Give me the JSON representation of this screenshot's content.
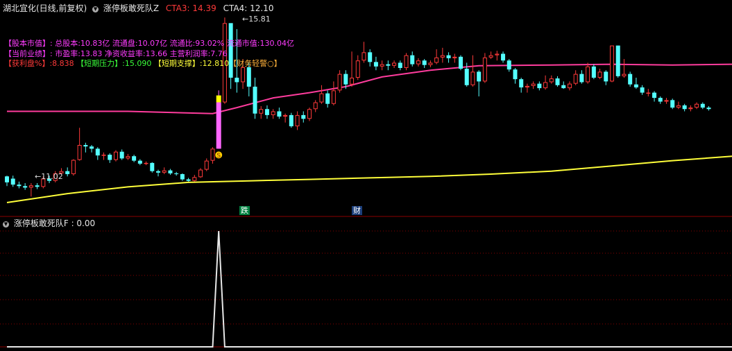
{
  "header": {
    "title": "湖北宜化(日线,前复权)",
    "indicator": "涨停板敢死队Z",
    "cta3_label": "CTA3:",
    "cta3_value": "14.39",
    "cta4_label": "CTA4:",
    "cta4_value": "12.10"
  },
  "info": {
    "row1": {
      "tag": "【股本市值】:",
      "text": "总股本:10.83亿 流通盘:10.07亿 流通比:93.02% 流通市值:130.04亿"
    },
    "row2": {
      "tag": "【当前业绩】:",
      "text": "市盈率:13.83 净资收益率:13.66 主营利润率:7.76"
    },
    "row3": {
      "profit_label": "【获利盘%】:",
      "profit_value": "8.838",
      "pressure_label": "【短期压力】:",
      "pressure_value": "15.090",
      "support_label": "【短期支撑】:",
      "support_value": "12.810",
      "warn": "【财务轻警○】"
    }
  },
  "markers": {
    "high_label": "15.81",
    "low_label": "11.02",
    "signal_icon": "S",
    "tag_die": "跌",
    "tag_cai": "财"
  },
  "sub_panel": {
    "title": "涨停板敢死队F",
    "value_label": ": 0.00"
  },
  "colors": {
    "up": "#ff3a3a",
    "down": "#54ffff",
    "ma1": "#ff3c9d",
    "ma2": "#ffff3a",
    "signal": "#ff66ff",
    "signal_top": "#ffff00",
    "grid": "#8b0000",
    "white": "#e8e8e8",
    "tag_die_bg": "#008040",
    "tag_cai_bg": "#1c3e7a"
  },
  "chart_data": [
    {
      "type": "candlestick",
      "series": [
        {
          "name": "candles",
          "values": [
            [
              11.56,
              11.4,
              11.58,
              11.3
            ],
            [
              11.5,
              11.34,
              11.58,
              11.28
            ],
            [
              11.34,
              11.3,
              11.42,
              11.24
            ],
            [
              11.3,
              11.26,
              11.38,
              11.2
            ],
            [
              11.26,
              11.32,
              11.38,
              11.02
            ],
            [
              11.32,
              11.28,
              11.38,
              11.22
            ],
            [
              11.28,
              11.5,
              11.56,
              11.24
            ],
            [
              11.5,
              11.44,
              11.58,
              11.38
            ],
            [
              11.44,
              11.64,
              11.7,
              11.4
            ],
            [
              11.64,
              11.7,
              11.78,
              11.6
            ],
            [
              11.7,
              11.62,
              11.8,
              11.56
            ],
            [
              11.62,
              12.0,
              12.02,
              11.58
            ],
            [
              12.0,
              12.4,
              12.86,
              11.98
            ],
            [
              12.4,
              12.36,
              12.46,
              12.2
            ],
            [
              12.36,
              12.3,
              12.4,
              12.2
            ],
            [
              12.3,
              12.12,
              12.34,
              12.0
            ],
            [
              12.12,
              12.14,
              12.2,
              12.0
            ],
            [
              12.14,
              12.0,
              12.18,
              11.92
            ],
            [
              12.0,
              12.22,
              12.26,
              11.96
            ],
            [
              12.22,
              12.04,
              12.28,
              12.0
            ],
            [
              12.04,
              12.1,
              12.16,
              12.0
            ],
            [
              12.1,
              11.98,
              12.14,
              11.94
            ],
            [
              11.98,
              11.9,
              12.02,
              11.86
            ],
            [
              11.9,
              11.92,
              11.96,
              11.86
            ],
            [
              11.92,
              11.7,
              11.94,
              11.66
            ],
            [
              11.7,
              11.66,
              11.74,
              11.56
            ],
            [
              11.66,
              11.72,
              11.8,
              11.62
            ],
            [
              11.72,
              11.64,
              11.76,
              11.6
            ],
            [
              11.64,
              11.62,
              11.68,
              11.58
            ],
            [
              11.62,
              11.48,
              11.64,
              11.44
            ],
            [
              11.48,
              11.44,
              11.52,
              11.42
            ],
            [
              11.44,
              11.54,
              11.6,
              11.42
            ],
            [
              11.54,
              11.74,
              11.78,
              11.52
            ],
            [
              11.74,
              11.98,
              12.04,
              11.7
            ],
            [
              11.98,
              12.3,
              12.34,
              11.9
            ],
            [
              12.3,
              13.54,
              13.86,
              12.3
            ],
            [
              13.54,
              15.66,
              15.81,
              13.5
            ],
            [
              15.66,
              14.2,
              14.6,
              13.9
            ],
            [
              14.2,
              14.08,
              15.5,
              13.8
            ],
            [
              14.08,
              14.48,
              14.7,
              13.9
            ],
            [
              14.48,
              13.96,
              14.6,
              13.7
            ],
            [
              13.96,
              13.24,
              14.2,
              13.1
            ],
            [
              13.24,
              13.36,
              13.44,
              13.1
            ],
            [
              13.36,
              13.2,
              13.46,
              13.1
            ],
            [
              13.2,
              13.3,
              13.36,
              13.1
            ],
            [
              13.3,
              13.16,
              13.4,
              13.1
            ],
            [
              13.16,
              13.2,
              13.24,
              13.0
            ],
            [
              13.2,
              12.9,
              13.26,
              12.86
            ],
            [
              12.9,
              13.2,
              13.3,
              12.8
            ],
            [
              13.2,
              13.1,
              13.3,
              13.0
            ],
            [
              13.1,
              13.36,
              13.4,
              13.04
            ],
            [
              13.36,
              13.54,
              13.6,
              13.28
            ],
            [
              13.54,
              13.78,
              14.0,
              13.5
            ],
            [
              13.78,
              13.5,
              13.86,
              13.4
            ],
            [
              13.5,
              13.86,
              14.1,
              13.46
            ],
            [
              13.86,
              14.3,
              14.4,
              13.8
            ],
            [
              14.3,
              14.02,
              14.4,
              13.9
            ],
            [
              14.02,
              14.2,
              14.9,
              13.96
            ],
            [
              14.2,
              14.66,
              14.8,
              14.14
            ],
            [
              14.66,
              14.88,
              15.16,
              14.6
            ],
            [
              14.88,
              14.62,
              14.96,
              14.5
            ],
            [
              14.62,
              14.5,
              14.76,
              14.4
            ],
            [
              14.5,
              14.56,
              14.66,
              14.4
            ],
            [
              14.56,
              14.52,
              14.66,
              14.4
            ],
            [
              14.52,
              14.6,
              14.66,
              14.46
            ],
            [
              14.6,
              14.46,
              14.66,
              14.4
            ],
            [
              14.46,
              14.8,
              14.86,
              14.4
            ],
            [
              14.8,
              14.56,
              14.9,
              14.5
            ],
            [
              14.56,
              14.66,
              14.72,
              14.5
            ],
            [
              14.66,
              14.54,
              14.7,
              14.46
            ],
            [
              14.54,
              14.6,
              14.66,
              14.48
            ],
            [
              14.6,
              14.74,
              14.96,
              14.56
            ],
            [
              14.74,
              14.8,
              15.0,
              14.6
            ],
            [
              14.8,
              14.72,
              14.88,
              14.6
            ],
            [
              14.72,
              14.76,
              14.84,
              14.6
            ],
            [
              14.76,
              14.44,
              14.8,
              14.4
            ],
            [
              14.44,
              14.0,
              14.6,
              13.96
            ],
            [
              14.0,
              14.36,
              14.8,
              13.96
            ],
            [
              14.36,
              14.1,
              14.4,
              13.7
            ],
            [
              14.1,
              14.74,
              14.86,
              14.06
            ],
            [
              14.74,
              14.8,
              14.9,
              14.7
            ],
            [
              14.8,
              14.84,
              14.92,
              14.66
            ],
            [
              14.84,
              14.66,
              14.9,
              14.6
            ],
            [
              14.66,
              14.42,
              14.7,
              14.36
            ],
            [
              14.42,
              14.16,
              14.46,
              14.04
            ],
            [
              14.16,
              13.94,
              14.2,
              13.8
            ],
            [
              13.94,
              13.98,
              14.04,
              13.8
            ],
            [
              13.98,
              14.04,
              14.1,
              13.9
            ],
            [
              14.04,
              13.92,
              14.1,
              13.86
            ],
            [
              13.92,
              14.08,
              14.26,
              13.88
            ],
            [
              14.08,
              14.18,
              14.26,
              14.04
            ],
            [
              14.18,
              14.0,
              14.24,
              13.96
            ],
            [
              14.0,
              13.92,
              14.1,
              13.9
            ],
            [
              13.92,
              14.04,
              14.1,
              13.86
            ],
            [
              14.04,
              14.3,
              14.4,
              14.0
            ],
            [
              14.3,
              14.08,
              14.4,
              14.04
            ],
            [
              14.08,
              14.5,
              14.6,
              14.04
            ],
            [
              14.5,
              14.2,
              14.56,
              14.16
            ],
            [
              14.2,
              14.36,
              14.44,
              14.16
            ],
            [
              14.36,
              14.1,
              14.4,
              14.0
            ],
            [
              14.1,
              15.06,
              15.06,
              14.08
            ],
            [
              15.06,
              14.24,
              14.7,
              14.2
            ],
            [
              14.24,
              14.3,
              14.7,
              14.2
            ],
            [
              14.3,
              14.02,
              14.36,
              13.96
            ],
            [
              14.02,
              13.94,
              14.2,
              13.9
            ],
            [
              13.94,
              13.8,
              14.0,
              13.74
            ],
            [
              13.8,
              13.8,
              13.9,
              13.7
            ],
            [
              13.8,
              13.66,
              13.84,
              13.56
            ],
            [
              13.66,
              13.56,
              13.7,
              13.5
            ],
            [
              13.56,
              13.6,
              13.66,
              13.5
            ],
            [
              13.6,
              13.4,
              13.64,
              13.36
            ],
            [
              13.4,
              13.46,
              13.56,
              13.36
            ],
            [
              13.46,
              13.36,
              13.5,
              13.3
            ],
            [
              13.36,
              13.4,
              13.46,
              13.3
            ],
            [
              13.4,
              13.5,
              13.54,
              13.36
            ],
            [
              13.5,
              13.4,
              13.54,
              13.36
            ],
            [
              13.4,
              13.36,
              13.44,
              13.32
            ]
          ]
        },
        {
          "name": "CTA3",
          "values": [
            [
              0,
              13.3
            ],
            [
              20,
              13.3
            ],
            [
              34,
              13.24
            ],
            [
              38,
              13.4
            ],
            [
              44,
              13.66
            ],
            [
              50,
              13.8
            ],
            [
              56,
              13.96
            ],
            [
              62,
              14.22
            ],
            [
              70,
              14.4
            ],
            [
              78,
              14.52
            ],
            [
              90,
              14.54
            ],
            [
              100,
              14.56
            ],
            [
              110,
              14.54
            ],
            [
              120,
              14.56
            ]
          ]
        },
        {
          "name": "CTA4",
          "values": [
            [
              0,
              10.86
            ],
            [
              10,
              11.1
            ],
            [
              20,
              11.28
            ],
            [
              30,
              11.4
            ],
            [
              40,
              11.44
            ],
            [
              50,
              11.48
            ],
            [
              60,
              11.52
            ],
            [
              70,
              11.56
            ],
            [
              80,
              11.62
            ],
            [
              90,
              11.7
            ],
            [
              100,
              11.84
            ],
            [
              110,
              11.98
            ],
            [
              120,
              12.1
            ]
          ]
        }
      ],
      "ylim": [
        10.6,
        16.0
      ]
    },
    {
      "type": "line",
      "series": [
        {
          "name": "涨停板敢死队F",
          "values": [
            [
              0,
              0
            ],
            [
              34,
              0
            ],
            [
              35,
              1
            ],
            [
              36,
              0
            ],
            [
              120,
              0
            ]
          ]
        }
      ],
      "ylim": [
        0,
        1
      ]
    }
  ]
}
